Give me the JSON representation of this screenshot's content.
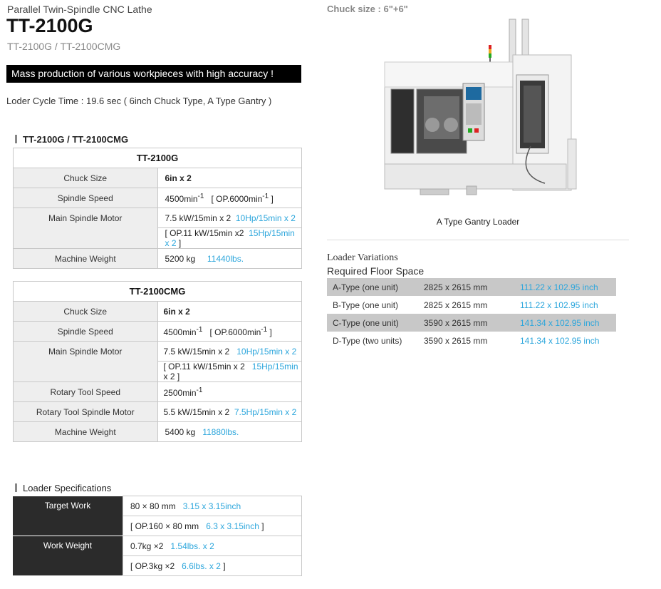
{
  "header": {
    "subtitle": "Parallel Twin-Spindle CNC Lathe",
    "model": "TT-2100G",
    "variants": "TT-2100G / TT-2100CMG",
    "banner": "Mass production of various workpieces with high accuracy !",
    "cycle_time": "Loder Cycle Time : 19.6 sec ( 6inch Chuck Type, A Type Gantry )"
  },
  "spec_section": {
    "title": "TT-2100G / TT-2100CMG",
    "table1": {
      "header": "TT-2100G",
      "chuck_size": {
        "label": "Chuck Size",
        "value": "6in x 2"
      },
      "spindle_speed": {
        "label": "Spindle Speed",
        "value_pre": "4500min",
        "sup1": "-1",
        "value_mid": "[ OP.6000min",
        "sup2": "-1",
        "value_post": " ]"
      },
      "main_motor": {
        "label": "Main Spindle Motor",
        "value": "7.5 kW/15min x 2",
        "value_imp": "10Hp/15min x 2",
        "op_pre": "[ OP.11 kW/15min x2",
        "op_imp": "15Hp/15min x 2",
        "op_post": " ]"
      },
      "weight": {
        "label": "Machine Weight",
        "value": "5200 kg",
        "value_imp": "11440lbs."
      }
    },
    "table2": {
      "header": "TT-2100CMG",
      "chuck_size": {
        "label": "Chuck Size",
        "value": "6in x 2"
      },
      "spindle_speed": {
        "label": "Spindle Speed",
        "value_pre": "4500min",
        "sup1": "-1",
        "value_mid": "[ OP.6000min",
        "sup2": "-1",
        "value_post": " ]"
      },
      "main_motor": {
        "label": "Main Spindle Motor",
        "value": "7.5 kW/15min x 2",
        "value_imp": "10Hp/15min x 2",
        "op_pre": "[ OP.11 kW/15min x 2",
        "op_imp": "15Hp/15min",
        "op_post": " x 2 ]"
      },
      "rotary_speed": {
        "label": "Rotary Tool Speed",
        "value_pre": "2500min",
        "sup": "-1"
      },
      "rotary_motor": {
        "label": "Rotary Tool Spindle Motor",
        "value": "5.5 kW/15min x 2",
        "value_imp": "7.5Hp/15min x 2"
      },
      "weight": {
        "label": "Machine Weight",
        "value": "5400 kg",
        "value_imp": "11880lbs."
      }
    }
  },
  "loader_section": {
    "title": "Loader Specifications",
    "target_work": {
      "label": "Target Work",
      "value": "80 × 80 mm",
      "value_imp": "3.15 x 3.15inch",
      "op_pre": "[ OP.160 × 80 mm",
      "op_imp": "6.3 x 3.15inch",
      "op_post": " ]"
    },
    "work_weight": {
      "label": "Work Weight",
      "value": "0.7kg ×2",
      "value_imp": "1.54lbs. x 2",
      "op_pre": "[ OP.3kg ×2",
      "op_imp": "6.6lbs. x 2",
      "op_post": " ]"
    }
  },
  "right": {
    "chuck_size": "Chuck size : 6\"+6\"",
    "image_caption": "A Type Gantry Loader",
    "variations_title": "Loader Variations",
    "floor_space_title": "Required Floor Space",
    "rows": [
      {
        "type": "A-Type (one unit)",
        "mm": "2825 x 2615 mm",
        "inch": "111.22 x 102.95 inch"
      },
      {
        "type": "B-Type (one unit)",
        "mm": "2825 x 2615 mm",
        "inch": "111.22 x 102.95 inch"
      },
      {
        "type": "C-Type (one unit)",
        "mm": "3590 x 2615 mm",
        "inch": "141.34 x 102.95 inch"
      },
      {
        "type": "D-Type (two units)",
        "mm": "3590 x 2615 mm",
        "inch": "141.34 x 102.95 inch"
      }
    ]
  },
  "colors": {
    "accent_blue": "#2ca6dc",
    "banner_bg": "#000000",
    "label_bg": "#eeeeee",
    "loader_label_bg": "#2b2b2b"
  }
}
